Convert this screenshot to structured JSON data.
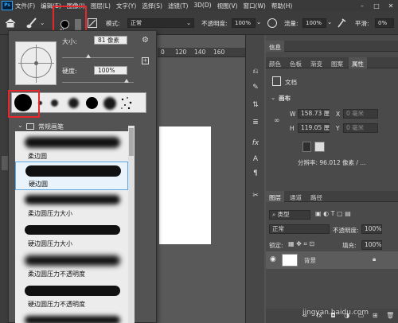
{
  "app": {
    "logo": "Ps"
  },
  "menu": [
    "文件(F)",
    "编辑(E)",
    "图像(I)",
    "图层(L)",
    "文字(Y)",
    "选择(S)",
    "滤镜(T)",
    "3D(D)",
    "视图(V)",
    "窗口(W)",
    "帮助(H)"
  ],
  "options_bar": {
    "brush_size_label": "81",
    "mode_label": "模式:",
    "mode_value": "正常",
    "opacity_label": "不透明度:",
    "opacity_value": "100%",
    "flow_label": "流量:",
    "flow_value": "100%",
    "smooth_label": "平滑:",
    "smooth_value": "0%"
  },
  "ruler": {
    "ticks": [
      "0",
      "120",
      "140",
      "160"
    ]
  },
  "brush_panel": {
    "size_label": "大小:",
    "size_value": "81 像素",
    "hardness_label": "硬度:",
    "hardness_value": "100%",
    "size_slider_level": 0.45,
    "hardness_slider_level": 1.0,
    "folder_name": "常规画笔",
    "brushes": [
      {
        "name": "柔边圆"
      },
      {
        "name": "硬边圆"
      },
      {
        "name": "柔边圆压力大小"
      },
      {
        "name": "硬边圆压力大小"
      },
      {
        "name": "柔边圆压力不透明度"
      },
      {
        "name": "硬边圆压力不透明度"
      }
    ]
  },
  "right_panels": {
    "top_tab": "信息",
    "tabs": [
      "颜色",
      "色板",
      "渐变",
      "图案",
      "属性"
    ],
    "doc_label": "文档",
    "canvas_section": "画布",
    "w_label": "W",
    "w_value": "158.73 厘",
    "x_label": "X",
    "x_value": "0 毫米",
    "h_label": "H",
    "h_value": "119.05 厘",
    "y_label": "Y",
    "y_value": "0 毫米",
    "resolution": "分辨率: 96.012 像素 / ...",
    "layers_tabs": [
      "图层",
      "通道",
      "路径"
    ],
    "filter_type": "类型",
    "blend_mode": "正常",
    "layer_opacity_label": "不透明度:",
    "layer_opacity_value": "100%",
    "lock_label": "锁定:",
    "fill_label": "填充:",
    "fill_value": "100%",
    "layer_name": "背景"
  },
  "watermark": "jingyan.baidu.com",
  "colors": {
    "highlight": "#e8262b",
    "selection": "#5aa9e6"
  }
}
